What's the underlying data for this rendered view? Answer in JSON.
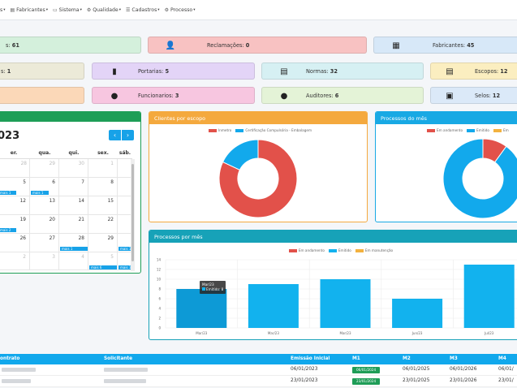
{
  "nav": [
    {
      "label": "s",
      "icon": "caret"
    },
    {
      "label": "Fabricantes",
      "icon": "book-icon"
    },
    {
      "label": "Sistema",
      "icon": "monitor-icon"
    },
    {
      "label": "Qualidade",
      "icon": "gear-icon"
    },
    {
      "label": "Cadastros",
      "icon": "list-icon"
    },
    {
      "label": "Processo",
      "icon": "cogs-icon"
    }
  ],
  "cards": [
    {
      "label": "s: 61",
      "color": "#d4f0dc"
    },
    {
      "label": "Reclamações: 0",
      "color": "#f8c2c2",
      "icon": "user-alert-icon"
    },
    {
      "label": "Fabricantes: 45",
      "color": "#d7e8f8",
      "icon": "building-icon"
    },
    {
      "label": "s: 1",
      "color": "#ecead8"
    },
    {
      "label": "Portarias: 5",
      "color": "#e3d4f7",
      "icon": "document-icon"
    },
    {
      "label": "Normas: 32",
      "color": "#d6f0f3",
      "icon": "docs-icon"
    },
    {
      "label": "Escopos: 12",
      "color": "#fbeec0",
      "icon": "list-file-icon"
    },
    {
      "label": "",
      "color": "#fbd8b8"
    },
    {
      "label": "Funcionarios: 3",
      "color": "#f7c6e0",
      "icon": "person-icon"
    },
    {
      "label": "Auditores: 6",
      "color": "#e4f3d7",
      "icon": "auditor-icon"
    },
    {
      "label": "Selos: 12",
      "color": "#dbe9f8",
      "icon": "image-icon"
    }
  ],
  "calendar": {
    "title": "023",
    "prev_label": "‹",
    "next_label": "›",
    "day_headers": [
      "er.",
      "qua.",
      "qui.",
      "sex.",
      "sáb."
    ],
    "rows": [
      [
        "",
        "29",
        "30",
        "1",
        ""
      ],
      [
        "5",
        "6",
        "7",
        "8",
        ""
      ],
      [
        "12",
        "13",
        "14",
        "15",
        ""
      ],
      [
        "19",
        "20",
        "21",
        "22",
        ""
      ],
      [
        "26",
        "27",
        "28",
        "29",
        ""
      ],
      [
        "2",
        "3",
        "4",
        "5",
        ""
      ]
    ],
    "first_row_partial": "28",
    "events": [
      "mais 1",
      "mais 1",
      "mais 2",
      "mais 1",
      "mais 1",
      "mais 6",
      "mais 1"
    ]
  },
  "chart_clientes": {
    "title": "Clientes por escopo",
    "header_color": "#f4a93e",
    "chart_data": {
      "type": "pie",
      "title": "Clientes por escopo",
      "legend_position": "top",
      "slices": [
        {
          "name": "Inmetro",
          "value": 82,
          "color": "#e2514a"
        },
        {
          "name": "Certificação Compulsória - Embalagem",
          "value": 18,
          "color": "#12a9ec"
        }
      ]
    }
  },
  "chart_mes": {
    "title": "Processos do mês",
    "header_color": "#18a9e4",
    "chart_data": {
      "type": "pie",
      "title": "Processos do mês",
      "legend_position": "top",
      "slices": [
        {
          "name": "Em andamento",
          "value": 10,
          "color": "#e2514a"
        },
        {
          "name": "Emitido",
          "value": 90,
          "color": "#12a9ec"
        },
        {
          "name": "Em",
          "value": 0,
          "color": "#f3b23f"
        }
      ]
    }
  },
  "chart_processos": {
    "title": "Processos por mês",
    "header_color": "#17a2b8",
    "tooltip": {
      "title": "Mar/23",
      "label": "Emitido: 8"
    },
    "chart_data": {
      "type": "bar",
      "title": "Processos por mês",
      "categories": [
        "Mar/23",
        "Mar/23",
        "Mar/23",
        "Jun/23",
        "Jul/23"
      ],
      "series": [
        {
          "name": "Em andamento",
          "values": [
            0,
            0,
            0,
            0,
            0
          ],
          "color": "#e2514a"
        },
        {
          "name": "Emitido",
          "values": [
            8,
            9,
            10,
            6,
            13
          ],
          "color": "#12b2ee"
        },
        {
          "name": "Em manutenção",
          "values": [
            0,
            0,
            0,
            0,
            0
          ],
          "color": "#f3b23f"
        }
      ],
      "ylim": [
        0,
        14
      ],
      "yticks": [
        0,
        2,
        4,
        6,
        8,
        10,
        12,
        14
      ],
      "grid": true,
      "legend_position": "top"
    }
  },
  "table": {
    "headers": [
      "ontrato",
      "Solicitante",
      "Emissão Inicial",
      "M1",
      "M2",
      "M3",
      "M4"
    ],
    "rows": [
      {
        "emissao": "06/01/2023",
        "m1": "06/01/2024",
        "m2": "06/01/2025",
        "m3": "06/01/2026",
        "m4": "06/01/"
      },
      {
        "emissao": "23/01/2023",
        "m1": "23/01/2024",
        "m2": "23/01/2025",
        "m3": "23/01/2026",
        "m4": "23/01/"
      }
    ]
  }
}
